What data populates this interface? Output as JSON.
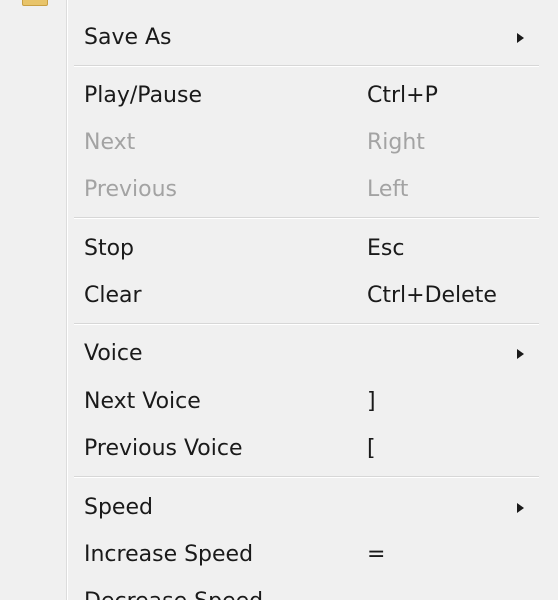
{
  "menu": {
    "items": [
      {
        "label": "Save As",
        "shortcut": "",
        "submenu": true,
        "enabled": true,
        "icon": "chevron-right-icon"
      },
      {
        "label": "Play/Pause",
        "shortcut": "Ctrl+P",
        "submenu": false,
        "enabled": true
      },
      {
        "label": "Next",
        "shortcut": "Right",
        "submenu": false,
        "enabled": false
      },
      {
        "label": "Previous",
        "shortcut": "Left",
        "submenu": false,
        "enabled": false
      },
      {
        "label": "Stop",
        "shortcut": "Esc",
        "submenu": false,
        "enabled": true
      },
      {
        "label": "Clear",
        "shortcut": "Ctrl+Delete",
        "submenu": false,
        "enabled": true
      },
      {
        "label": "Voice",
        "shortcut": "",
        "submenu": true,
        "enabled": true,
        "icon": "chevron-right-icon"
      },
      {
        "label": "Next Voice",
        "shortcut": "]",
        "submenu": false,
        "enabled": true
      },
      {
        "label": "Previous Voice",
        "shortcut": "[",
        "submenu": false,
        "enabled": true
      },
      {
        "label": "Speed",
        "shortcut": "",
        "submenu": true,
        "enabled": true,
        "icon": "chevron-right-icon"
      },
      {
        "label": "Increase Speed",
        "shortcut": "=",
        "submenu": false,
        "enabled": true
      },
      {
        "label": "Decrease Speed",
        "shortcut": "",
        "submenu": false,
        "enabled": true
      }
    ]
  },
  "icons": {
    "top": "folder-icon"
  },
  "colors": {
    "menu_background": "#f0f0f0",
    "text": "#1a1a1a",
    "disabled_text": "#a3a3a3",
    "separator": "#d7d7d7",
    "folder": "#e8c46a"
  }
}
